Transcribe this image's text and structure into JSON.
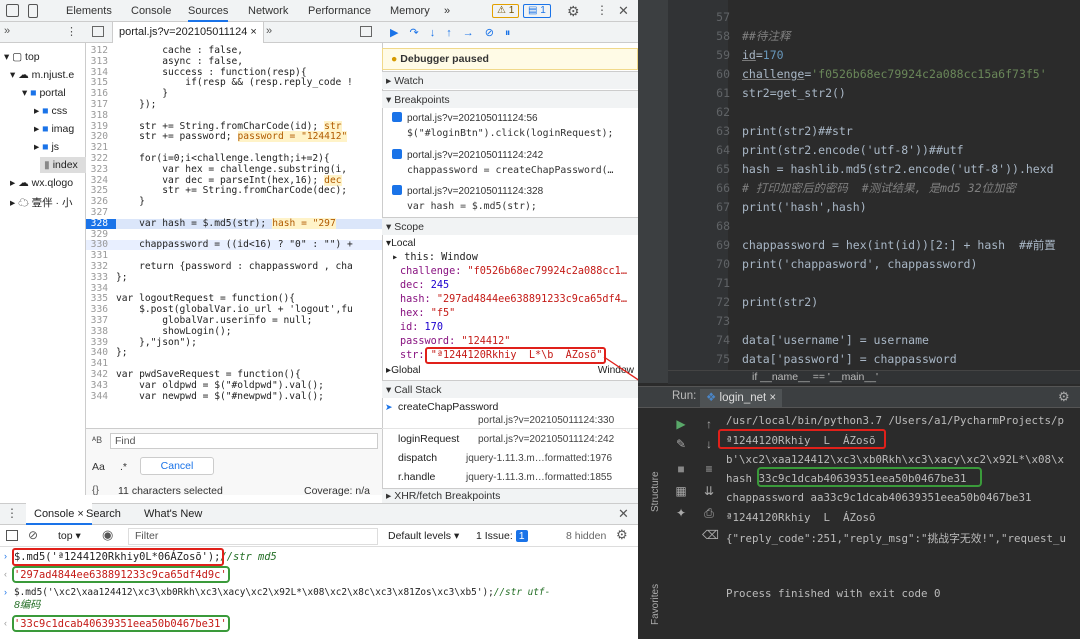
{
  "devtools": {
    "tabs": [
      "Elements",
      "Console",
      "Sources",
      "Network",
      "Performance",
      "Memory",
      "»"
    ],
    "badge_warn": "1",
    "badge_info": "1",
    "file_tab": "portal.js?v=202105011124",
    "tree": {
      "top": "top",
      "origin": "m.njust.e",
      "portal": "portal",
      "css": "css",
      "images": "imag",
      "js": "js",
      "index": "index",
      "wx": "wx.qlogo",
      "app": "壹伴 · 小"
    },
    "code": [
      {
        "n": "312",
        "t": "        cache : false,"
      },
      {
        "n": "313",
        "t": "        async : false,"
      },
      {
        "n": "314",
        "t": "        success : function(resp){"
      },
      {
        "n": "315",
        "t": "            if(resp && (resp.reply_code !"
      },
      {
        "n": "316",
        "t": "        }"
      },
      {
        "n": "317",
        "t": "    });"
      },
      {
        "n": "318",
        "t": ""
      },
      {
        "n": "319",
        "t": "    str += String.fromCharCode(id);"
      },
      {
        "n": "320",
        "t": "    str += password;"
      },
      {
        "n": "321",
        "t": ""
      },
      {
        "n": "322",
        "t": "    for(i=0;i<challenge.length;i+=2){"
      },
      {
        "n": "323",
        "t": "        var hex = challenge.substring(i,"
      },
      {
        "n": "324",
        "t": "        var dec = parseInt(hex,16);"
      },
      {
        "n": "325",
        "t": "        str += String.fromCharCode(dec);"
      },
      {
        "n": "326",
        "t": "    }"
      },
      {
        "n": "327",
        "t": ""
      },
      {
        "n": "328",
        "t": "    var hash = $.md5(str);"
      },
      {
        "n": "329",
        "t": ""
      },
      {
        "n": "330",
        "t": "    chappassword = ((id<16) ? \"0\" : \"\") +"
      },
      {
        "n": "331",
        "t": ""
      },
      {
        "n": "332",
        "t": "    return {password : chappassword , cha"
      },
      {
        "n": "333",
        "t": "};"
      },
      {
        "n": "334",
        "t": ""
      },
      {
        "n": "335",
        "t": "var logoutRequest = function(){"
      },
      {
        "n": "336",
        "t": "    $.post(globalVar.io_url + 'logout',fu"
      },
      {
        "n": "337",
        "t": "        globalVar.userinfo = null;"
      },
      {
        "n": "338",
        "t": "        showLogin();"
      },
      {
        "n": "339",
        "t": "    },\"json\");"
      },
      {
        "n": "340",
        "t": "};"
      },
      {
        "n": "341",
        "t": ""
      },
      {
        "n": "342",
        "t": "var pwdSaveRequest = function(){"
      },
      {
        "n": "343",
        "t": "    var oldpwd = $(\"#oldpwd\").val();"
      },
      {
        "n": "344",
        "t": "    var newpwd = $(\"#newpwd\").val();"
      }
    ],
    "inline_values": {
      "str319": "str",
      "pwd320": "password = \"124412\"",
      "dec324": "dec",
      "hash328": "hash = \"297"
    },
    "find": {
      "placeholder": "Find",
      "cancel": "Cancel",
      "selected": "11 characters selected",
      "coverage": "Coverage: n/a",
      "aa": "Aa",
      "regex": ".*",
      "braces": "{}"
    },
    "paused_banner": "Debugger paused",
    "sections": {
      "watch": "Watch",
      "breakpoints": "Breakpoints",
      "scope": "Scope",
      "callstack": "Call Stack",
      "xhr": "XHR/fetch Breakpoints"
    },
    "breakpoints": [
      {
        "file": "portal.js?v=202105011124:56",
        "code": "$(\"#loginBtn\").click(loginRequest);"
      },
      {
        "file": "portal.js?v=202105011124:242",
        "code": "chappassword = createChapPassword(…"
      },
      {
        "file": "portal.js?v=202105011124:328",
        "code": "var hash = $.md5(str);"
      }
    ],
    "scope": {
      "local": "Local",
      "this_k": "this:",
      "this_v": "Window",
      "challenge_k": "challenge:",
      "challenge_v": "\"f0526b68ec79924c2a088cc1…",
      "dec_k": "dec:",
      "dec_v": "245",
      "hash_k": "hash:",
      "hash_v": "\"297ad4844ee638891233c9ca65df4…",
      "hex_k": "hex:",
      "hex_v": "\"f5\"",
      "id_k": "id:",
      "id_v": "170",
      "password_k": "password:",
      "password_v": "\"124412\"",
      "str_k": "str:",
      "str_v": "\"ª1244120Rkhiy  L*\\b  ÁZosõ\"",
      "global": "Global",
      "global_v": "Window"
    },
    "callstack": [
      {
        "fn": "createChapPassword",
        "loc": "portal.js?v=202105011124:330"
      },
      {
        "fn": "loginRequest",
        "loc": "portal.js?v=202105011124:242"
      },
      {
        "fn": "dispatch",
        "loc": "jquery-1.11.3.m…formatted:1976"
      },
      {
        "fn": "r.handle",
        "loc": "jquery-1.11.3.m…formatted:1855"
      }
    ],
    "console": {
      "tabs": [
        "Console",
        "Search",
        "What's New"
      ],
      "context": "top",
      "filter_placeholder": "Filter",
      "levels": "Default levels",
      "issues": "1 Issue:",
      "issues_count": "1",
      "hidden": "8 hidden",
      "line1_code": "$.md5('ª1244120Rkhiy0L*06ÁZosõ');",
      "line1_comment": "//str md5",
      "line2": "'297ad4844ee638891233c9ca65df4d9c'",
      "line3_code": "$.md5('\\xc2\\xaa124412\\xc3\\xb0Rkh\\xc3\\xacy\\xc2\\x92L*\\x08\\xc2\\x8c\\xc3\\x81Zos\\xc3\\xb5');",
      "line3_comment": "//str utf-",
      "line3b": "8编码",
      "line4": "'33c9c1dcab40639351eea50b0467be31'"
    }
  },
  "ide": {
    "lines": [
      {
        "n": "57",
        "html": ""
      },
      {
        "n": "58",
        "comment": "##待注释"
      },
      {
        "n": "59",
        "var": "id",
        "val": "170"
      },
      {
        "n": "60",
        "var": "challenge",
        "val": "'f0526b68ec79924c2a088cc15a6f73f5'"
      },
      {
        "n": "61",
        "plain": "str2=get_str2()"
      },
      {
        "n": "62",
        "plain": ""
      },
      {
        "n": "63",
        "plain": "print(str2)##str"
      },
      {
        "n": "64",
        "plain": "print(str2.encode('utf-8'))##utf"
      },
      {
        "n": "65",
        "plain": "hash = hashlib.md5(str2.encode('utf-8')).hexd"
      },
      {
        "n": "66",
        "comment": "# 打印加密后的密码  #测试结果, 是md5 32位加密"
      },
      {
        "n": "67",
        "plain": "print('hash',hash)"
      },
      {
        "n": "68",
        "plain": ""
      },
      {
        "n": "69",
        "plain": "chappassword = hex(int(id))[2:] + hash  ##前置"
      },
      {
        "n": "70",
        "plain": "print('chappasword', chappassword)"
      },
      {
        "n": "71",
        "plain": ""
      },
      {
        "n": "72",
        "plain": "print(str2)"
      },
      {
        "n": "73",
        "plain": ""
      },
      {
        "n": "74",
        "plain": "data['username'] = username"
      },
      {
        "n": "75",
        "plain": "data['password'] = chappassword"
      }
    ],
    "breadcrumb": "if __name__ == '__main__'",
    "run_label": "Run:",
    "run_config": "login_net",
    "output": [
      "/usr/local/bin/python3.7 /Users/a1/PycharmProjects/p",
      "ª1244120Rkhiy  L  ÁZosõ",
      "b'\\xc2\\xaa124412\\xc3\\xb0Rkh\\xc3\\xacy\\xc2\\x92L*\\x08\\x",
      "hash 33c9c1dcab40639351eea50b0467be31",
      "chappassword aa33c9c1dcab40639351eea50b0467be31",
      "ª1244120Rkhiy  L  ÁZosõ",
      "{\"reply_code\":251,\"reply_msg\":\"挑战字无效!\",\"request_u",
      "",
      "Process finished with exit code 0"
    ],
    "side_structure": "Structure",
    "side_favorites": "Favorites"
  }
}
